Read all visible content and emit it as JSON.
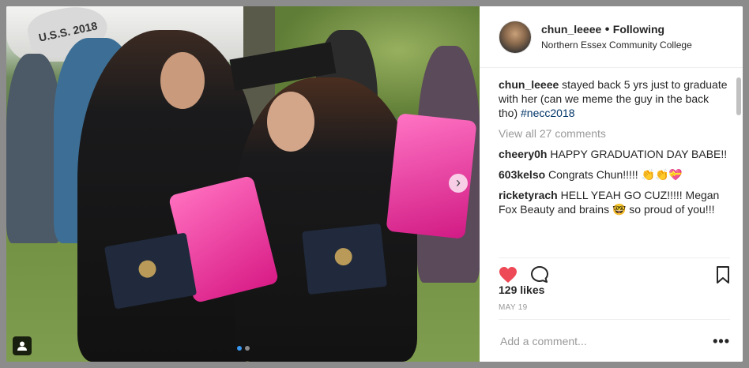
{
  "photo": {
    "balloon_text": "U.S.S. 2018",
    "next_icon": "chevron-right-icon",
    "user_tag_icon": "user-tag-icon",
    "carousel_dots": 2,
    "carousel_active": 0
  },
  "header": {
    "username": "chun_leeee",
    "separator": "•",
    "follow_label": "Following",
    "location": "Northern Essex Community College"
  },
  "caption": {
    "username": "chun_leeee",
    "text": " stayed back 5 yrs just to graduate with her (can we meme the guy in the back tho) ",
    "hashtag": "#necc2018"
  },
  "view_all": "View all 27 comments",
  "comments": [
    {
      "user": "cheery0h",
      "text": " HAPPY GRADUATION DAY BABE!!"
    },
    {
      "user": "603kelso",
      "text": " Congrats Chun!!!!! 👏👏💝"
    },
    {
      "user": "ricketyrach",
      "text": " HELL YEAH GO CUZ!!!!! Megan Fox Beauty and brains 🤓 so proud of you!!!"
    }
  ],
  "actions": {
    "like_icon": "heart-icon",
    "comment_icon": "comment-icon",
    "save_icon": "bookmark-icon",
    "liked_color": "#ed4956"
  },
  "likes": "129 likes",
  "date": "MAY 19",
  "add_comment": {
    "placeholder": "Add a comment...",
    "more_label": "•••"
  }
}
